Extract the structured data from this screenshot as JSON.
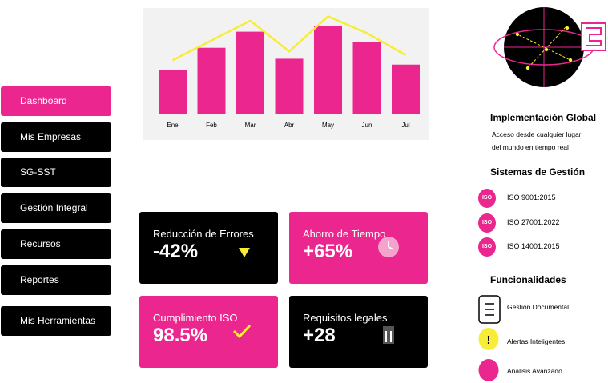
{
  "sidebar": {
    "items": [
      {
        "label": "Dashboard",
        "active": true
      },
      {
        "label": "Mis Empresas",
        "active": false
      },
      {
        "label": "SG-SST",
        "active": false
      },
      {
        "label": "Gestión Integral",
        "active": false
      },
      {
        "label": "Recursos",
        "active": false
      },
      {
        "label": "Reportes",
        "active": false
      },
      {
        "label": "Mis Herramientas",
        "active": false
      }
    ]
  },
  "chart_data": {
    "type": "bar",
    "categories": [
      "Ene",
      "Feb",
      "Mar",
      "Abr",
      "May",
      "Jun",
      "Jul"
    ],
    "values": [
      60,
      90,
      112,
      75,
      120,
      98,
      67
    ],
    "line_values": [
      73,
      100,
      127,
      85,
      133,
      110,
      80
    ],
    "ylim": [
      0,
      140
    ],
    "grid": false,
    "legend": "none",
    "title": "",
    "xlabel": "",
    "ylabel": "",
    "bar_color": "#ec268f",
    "line_color": "#f7ed36"
  },
  "metrics": {
    "errors": {
      "label": "Reducción de Errores",
      "value": "-42%",
      "icon": "down-triangle-icon"
    },
    "time": {
      "label": "Ahorro de Tiempo",
      "value": "+65%",
      "icon": "clock-icon"
    },
    "iso": {
      "label": "Cumplimiento ISO",
      "value": "98.5%",
      "icon": "checkmark-icon"
    },
    "legal": {
      "label": "Requisitos legales",
      "value": "+28",
      "icon": "document-bars-icon"
    }
  },
  "global": {
    "title": "Implementación Global",
    "description_line1": "Acceso desde cualquier lugar",
    "description_line2": "del mundo en tiempo real"
  },
  "systems": {
    "title": "Sistemas de Gestión",
    "badge": "ISO",
    "items": [
      "ISO 9001:2015",
      "ISO 27001:2022",
      "ISO 14001:2015"
    ]
  },
  "features": {
    "title": "Funcionalidades",
    "items": [
      {
        "label": "Gestión Documental",
        "icon": "document-icon"
      },
      {
        "label": "Alertas Inteligentes",
        "icon": "alert-icon",
        "glyph": "!"
      },
      {
        "label": "Análisis Avanzado",
        "icon": "analytics-icon"
      }
    ]
  },
  "colors": {
    "accent": "#ec268f",
    "highlight": "#f7ed36",
    "dark": "#000000",
    "panel": "#f2f2f2"
  }
}
